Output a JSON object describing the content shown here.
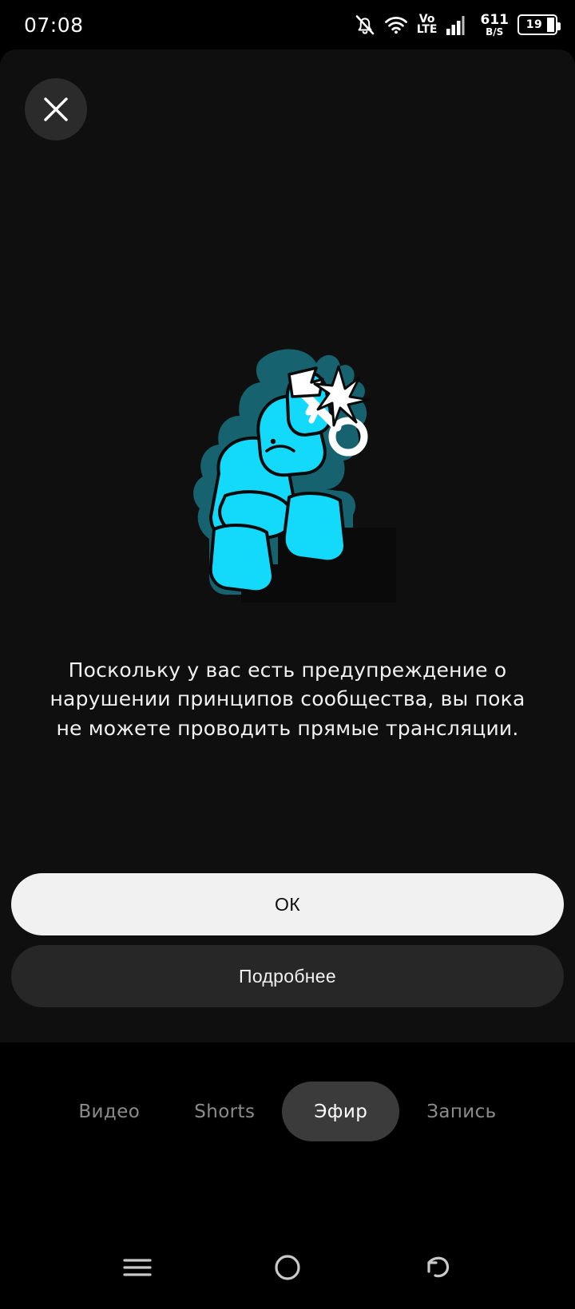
{
  "status_bar": {
    "time": "07:08",
    "icons": [
      "bell-muted-icon",
      "wifi-icon",
      "volte-icon",
      "signal-bars-icon"
    ],
    "volte_top": "Vo",
    "volte_bottom": "LTE",
    "network_speed_value": "611",
    "network_speed_unit": "B/S",
    "battery_level": "19"
  },
  "dialog": {
    "close_label": "Закрыть",
    "illustration_name": "blocked-streaming-character-illustration",
    "message": "Поскольку у вас есть предупреждение о нарушении принципов сообщества, вы пока не можете проводить прямые трансляции.",
    "primary_button": "ОК",
    "secondary_button": "Подробнее"
  },
  "mode_tabs": [
    {
      "label": "Видео",
      "active": false
    },
    {
      "label": "Shorts",
      "active": false
    },
    {
      "label": "Эфир",
      "active": true
    },
    {
      "label": "Запись",
      "active": false
    }
  ],
  "nav_bar": {
    "recents_label": "Недавние",
    "home_label": "Главная",
    "back_label": "Назад"
  },
  "colors": {
    "background": "#000000",
    "sheet": "#0f0f0f",
    "illustration_cyan": "#13d9fb",
    "illustration_teal": "#16636f",
    "illustration_white": "#ffffff",
    "primary_button_bg": "#f1f1f1",
    "secondary_button_bg": "#272727",
    "active_tab_bg": "#3b3b3b",
    "text_primary": "#f1f1f1",
    "text_muted": "#8b8b8b"
  }
}
